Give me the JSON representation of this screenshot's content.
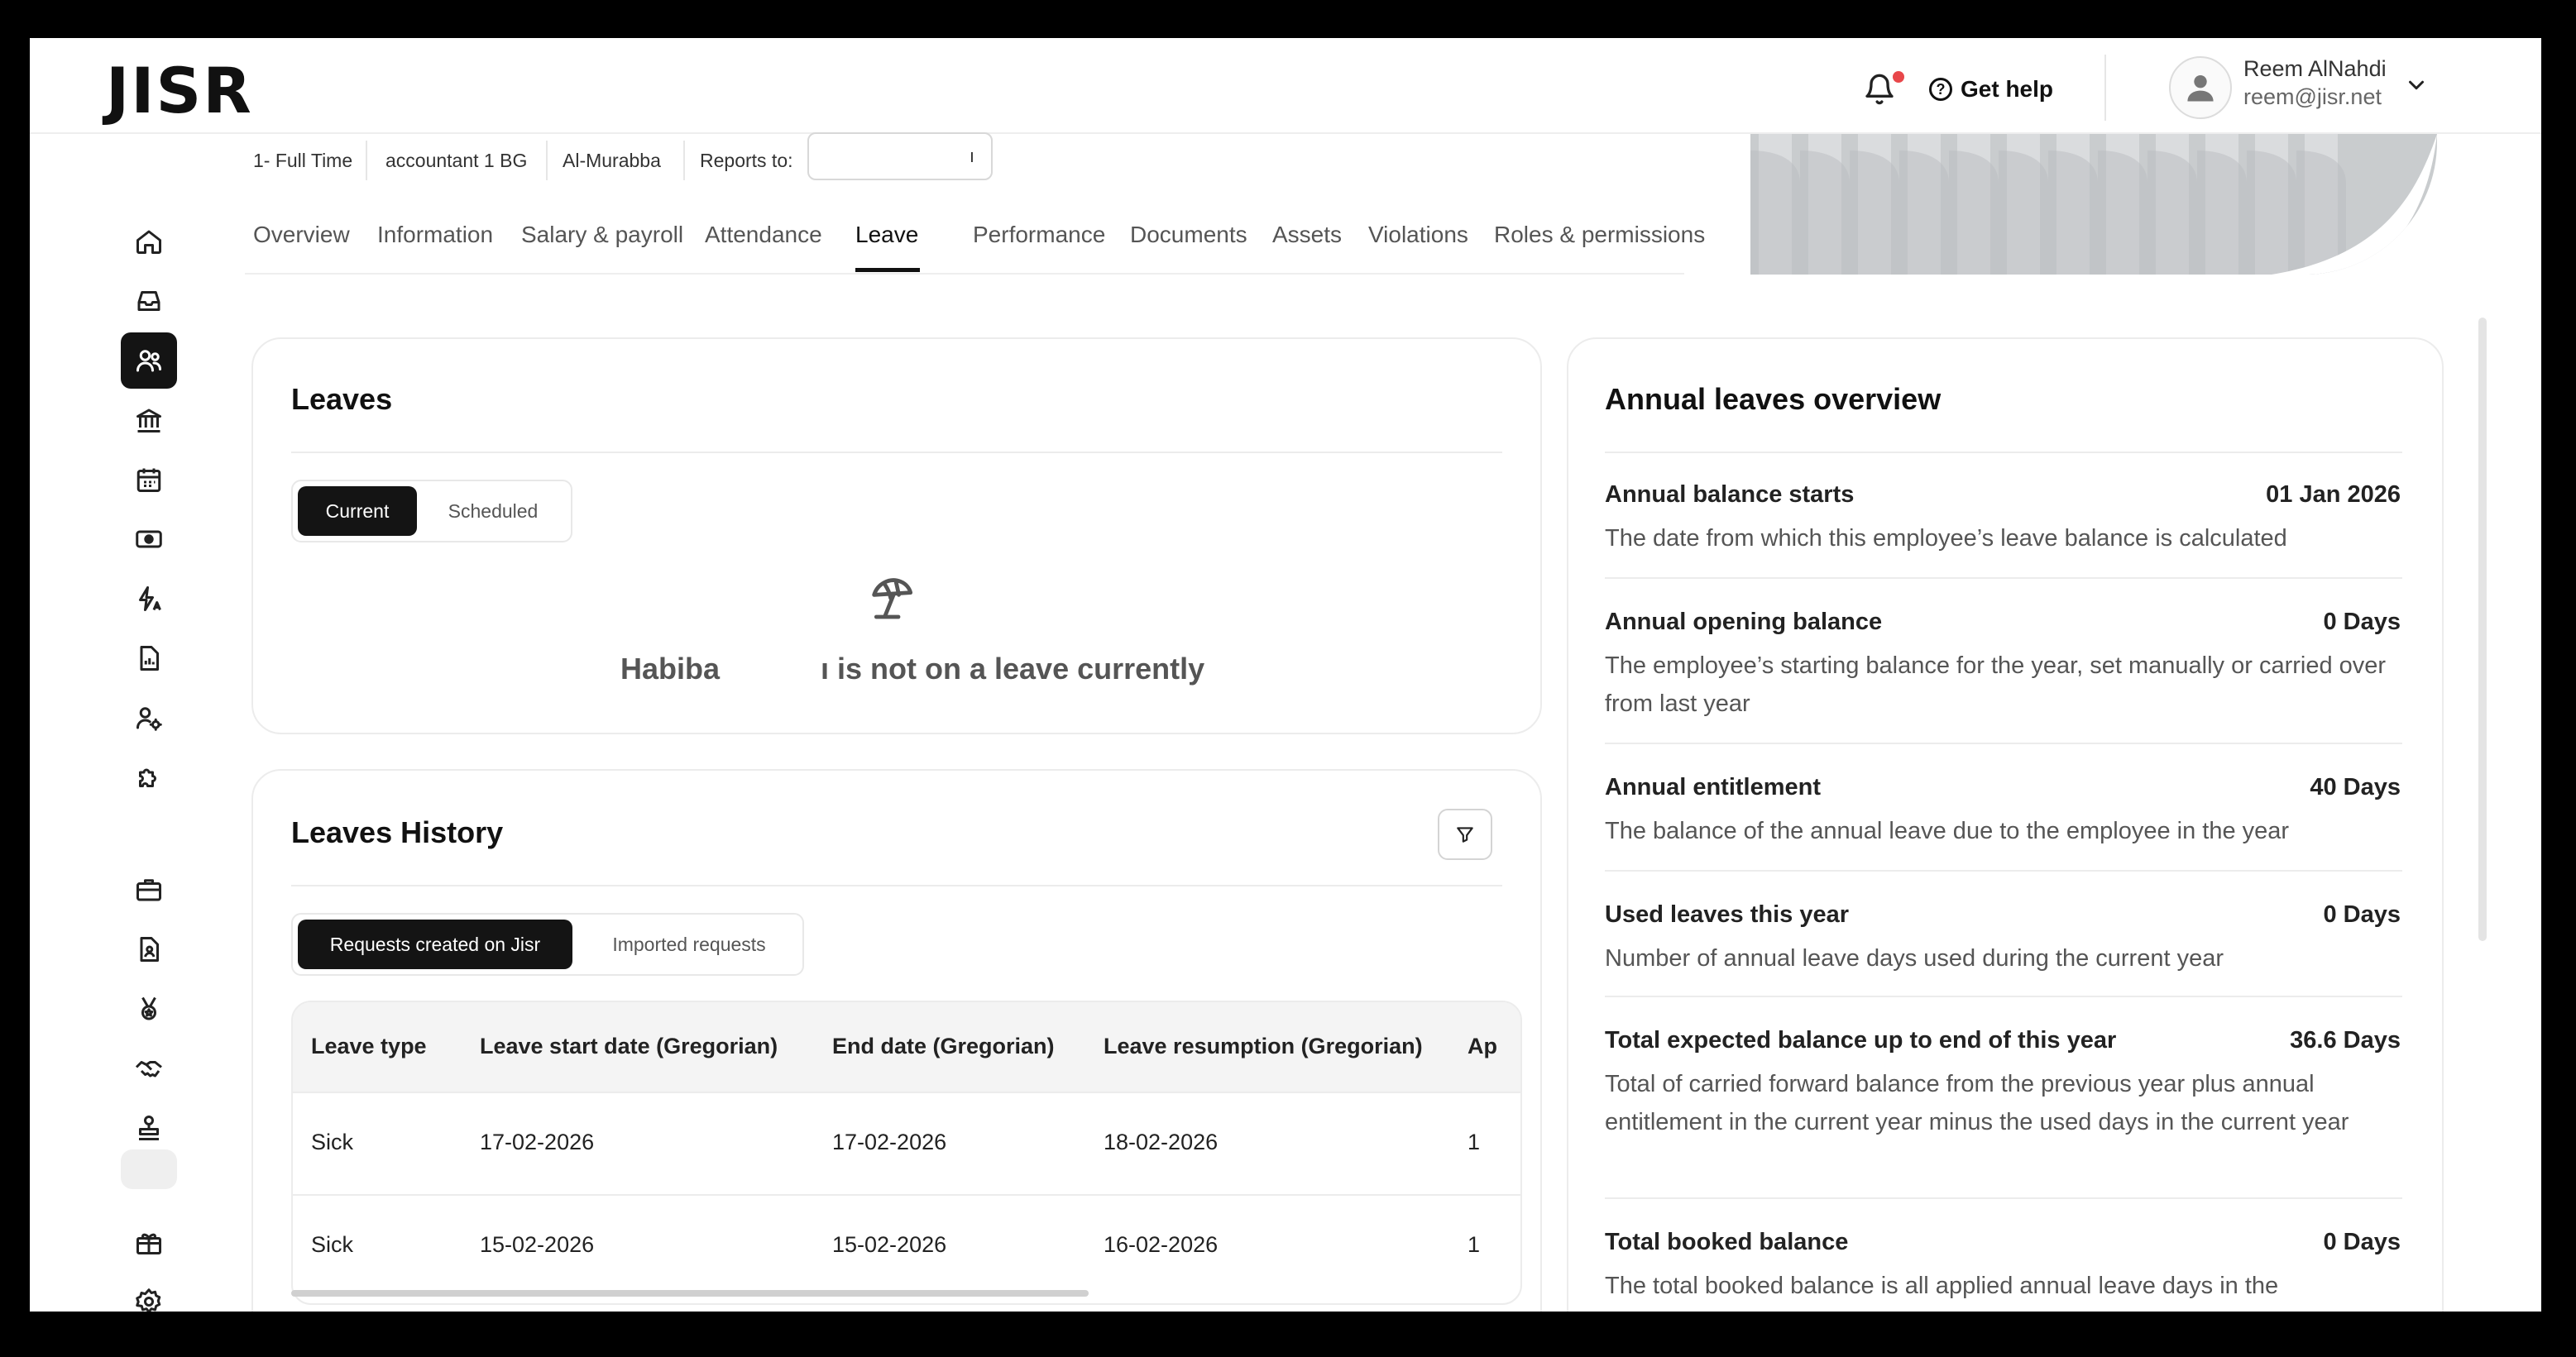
{
  "app": {
    "logo": "JISR"
  },
  "header": {
    "help_label": "Get help",
    "user_name": "Reem AlNahdi",
    "user_email": "reem@jisr.net"
  },
  "sidebar": {
    "items": [
      {
        "icon": "home-icon"
      },
      {
        "icon": "inbox-icon"
      },
      {
        "icon": "people-icon",
        "active": true
      },
      {
        "icon": "bank-icon"
      },
      {
        "icon": "calendar-icon"
      },
      {
        "icon": "money-icon"
      },
      {
        "icon": "automation-icon"
      },
      {
        "icon": "report-icon"
      },
      {
        "icon": "user-settings-icon"
      },
      {
        "icon": "puzzle-icon"
      },
      {
        "icon": "briefcase-icon"
      },
      {
        "icon": "document-user-icon"
      },
      {
        "icon": "medal-icon"
      },
      {
        "icon": "handshake-icon"
      },
      {
        "icon": "stamp-icon"
      },
      {
        "icon": "gift-icon"
      },
      {
        "icon": "gear-icon"
      }
    ]
  },
  "profile": {
    "employment_type": "1- Full Time",
    "position": "accountant 1 BG",
    "location": "Al-Murabba",
    "reports_label": "Reports to:",
    "reports_value": "ı"
  },
  "tabs": [
    "Overview",
    "Information",
    "Salary & payroll",
    "Attendance",
    "Leave",
    "Performance",
    "Documents",
    "Assets",
    "Violations",
    "Roles & permissions"
  ],
  "leaves": {
    "title": "Leaves",
    "seg_current": "Current",
    "seg_scheduled": "Scheduled",
    "empty_name": "Habiba",
    "empty_rest": "ı is not on a leave currently"
  },
  "history": {
    "title": "Leaves History",
    "seg_jisr": "Requests created on Jisr",
    "seg_imported": "Imported requests",
    "columns": [
      "Leave type",
      "Leave start date (Gregorian)",
      "End date (Gregorian)",
      "Leave resumption (Gregorian)",
      "Ap"
    ],
    "rows": [
      [
        "Sick",
        "17-02-2026",
        "17-02-2026",
        "18-02-2026",
        "1"
      ],
      [
        "Sick",
        "15-02-2026",
        "15-02-2026",
        "16-02-2026",
        "1"
      ]
    ]
  },
  "overview": {
    "title": "Annual leaves overview",
    "items": [
      {
        "label": "Annual balance starts",
        "value": "01 Jan 2026",
        "desc": "The date from which this employee’s leave balance is calculated"
      },
      {
        "label": "Annual opening balance",
        "value": "0 Days",
        "desc": "The employee’s starting balance for the year, set manually or carried over from last year"
      },
      {
        "label": "Annual entitlement",
        "value": "40 Days",
        "desc": "The balance of the annual leave due to the employee in the year"
      },
      {
        "label": "Used leaves this year",
        "value": "0 Days",
        "desc": "Number of annual leave days used during the current year"
      },
      {
        "label": "Total expected balance up to end of this year",
        "value": "36.6 Days",
        "desc": "Total of carried forward balance from the previous year plus annual entitlement in the current year minus the used days in the current year"
      },
      {
        "label": "Total booked balance",
        "value": "0 Days",
        "desc": "The total booked balance is all applied annual leave days in the"
      }
    ]
  }
}
